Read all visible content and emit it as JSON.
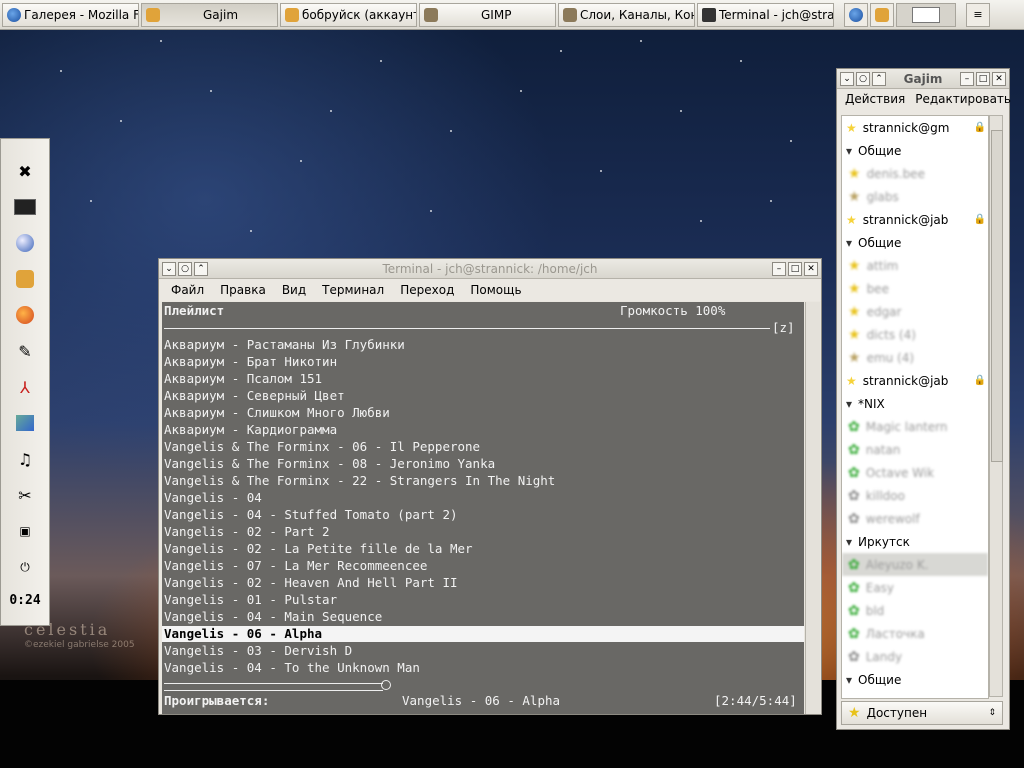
{
  "taskbar": {
    "tasks": [
      {
        "label": "Галерея - Mozilla Fire",
        "icon": "firefox-icon"
      },
      {
        "label": "Gajim",
        "icon": "gajim-icon"
      },
      {
        "label": "бобруйск (аккаунт:",
        "icon": "gajim-icon"
      },
      {
        "label": "GIMP",
        "icon": "gimp-icon"
      },
      {
        "label": "Слои, Каналы, Конт",
        "icon": "gimp-icon"
      },
      {
        "label": "Terminal - jch@stran",
        "icon": "terminal-icon"
      }
    ],
    "tray_icons": [
      "globe-icon",
      "gajim-icon",
      "desktop-switcher-icon",
      "notes-icon"
    ]
  },
  "left_panel": {
    "launchers": [
      "system-icon",
      "display-icon",
      "network-icon",
      "gajim-icon",
      "firefox-icon",
      "editor-icon",
      "pdf-icon",
      "screenshot-icon",
      "music-icon",
      "tools-icon",
      "lock-icon",
      "power-icon"
    ],
    "clock": "0:24"
  },
  "wallpaper": {
    "title": "celestia",
    "credit": "©ezekiel gabrielse 2005"
  },
  "terminal": {
    "title": "Terminal - jch@strannick: /home/jch",
    "menu": [
      "Файл",
      "Правка",
      "Вид",
      "Терминал",
      "Переход",
      "Помощь"
    ],
    "header_left": "Плейлист",
    "header_right": "Громкость 100%",
    "divider_right": "[z]",
    "playlist": [
      "Аквариум - Растаманы Из Глубинки",
      "Аквариум - Брат Никотин",
      "Аквариум - Псалом 151",
      "Аквариум - Северный Цвет",
      "Аквариум - Слишком Много Любви",
      "Аквариум - Кардиограмма",
      "Vangelis & The Forminx - 06 - Il Pepperone",
      "Vangelis & The Forminx - 08 - Jeronimo Yanka",
      "Vangelis & The Forminx - 22 - Strangers In The Night",
      "Vangelis - 04",
      "Vangelis - 04 - Stuffed Tomato (part 2)",
      "Vangelis - 02 - Part 2",
      "Vangelis - 02 - La Petite fille de la Mer",
      "Vangelis - 07 - La Mer Recommeencee",
      "Vangelis - 02 - Heaven And Hell Part II",
      "Vangelis - 01 - Pulstar",
      "Vangelis - 04 - Main Sequence",
      "Vangelis - 06 - Alpha",
      "Vangelis - 03 - Dervish D",
      "Vangelis - 04 - To the Unknown Man"
    ],
    "current_index": 17,
    "playing_label": "Проигрывается:",
    "playing_track": "Vangelis - 06 - Alpha",
    "time": "[2:44/5:44]",
    "progress": 0.4767
  },
  "gajim": {
    "title": "Gajim",
    "menu": [
      "Действия",
      "Редактировать"
    ],
    "roster": [
      {
        "type": "account",
        "label": "strannick@gm"
      },
      {
        "type": "group",
        "label": "Общие"
      },
      {
        "type": "contact",
        "label": "denis.bee",
        "icon": "star"
      },
      {
        "type": "contact",
        "label": "glabs",
        "icon": "star-away"
      },
      {
        "type": "account",
        "label": "strannick@jab"
      },
      {
        "type": "group",
        "label": "Общие"
      },
      {
        "type": "contact",
        "label": "attim",
        "icon": "star"
      },
      {
        "type": "contact",
        "label": "bee",
        "icon": "star"
      },
      {
        "type": "contact",
        "label": "edgar",
        "icon": "star"
      },
      {
        "type": "contact",
        "label": "dicts (4)",
        "icon": "star"
      },
      {
        "type": "contact",
        "label": "emu (4)",
        "icon": "star-away"
      },
      {
        "type": "account",
        "label": "strannick@jab"
      },
      {
        "type": "group",
        "label": "*NIX"
      },
      {
        "type": "contact",
        "label": "Magic lantern",
        "icon": "flower"
      },
      {
        "type": "contact",
        "label": "natan",
        "icon": "flower"
      },
      {
        "type": "contact",
        "label": "Octave Wik",
        "icon": "flower"
      },
      {
        "type": "contact",
        "label": "killdoo",
        "icon": "flower-off"
      },
      {
        "type": "contact",
        "label": "werewolf",
        "icon": "flower-off"
      },
      {
        "type": "group",
        "label": "Иркутск"
      },
      {
        "type": "contact",
        "label": "Aleyuzo K.",
        "icon": "flower",
        "selected": true
      },
      {
        "type": "contact",
        "label": "Easy",
        "icon": "flower"
      },
      {
        "type": "contact",
        "label": "bld",
        "icon": "flower"
      },
      {
        "type": "contact",
        "label": "Ласточка",
        "icon": "flower"
      },
      {
        "type": "contact",
        "label": "Landy",
        "icon": "flower-off"
      },
      {
        "type": "group",
        "label": "Общие"
      }
    ],
    "status": "Доступен"
  }
}
